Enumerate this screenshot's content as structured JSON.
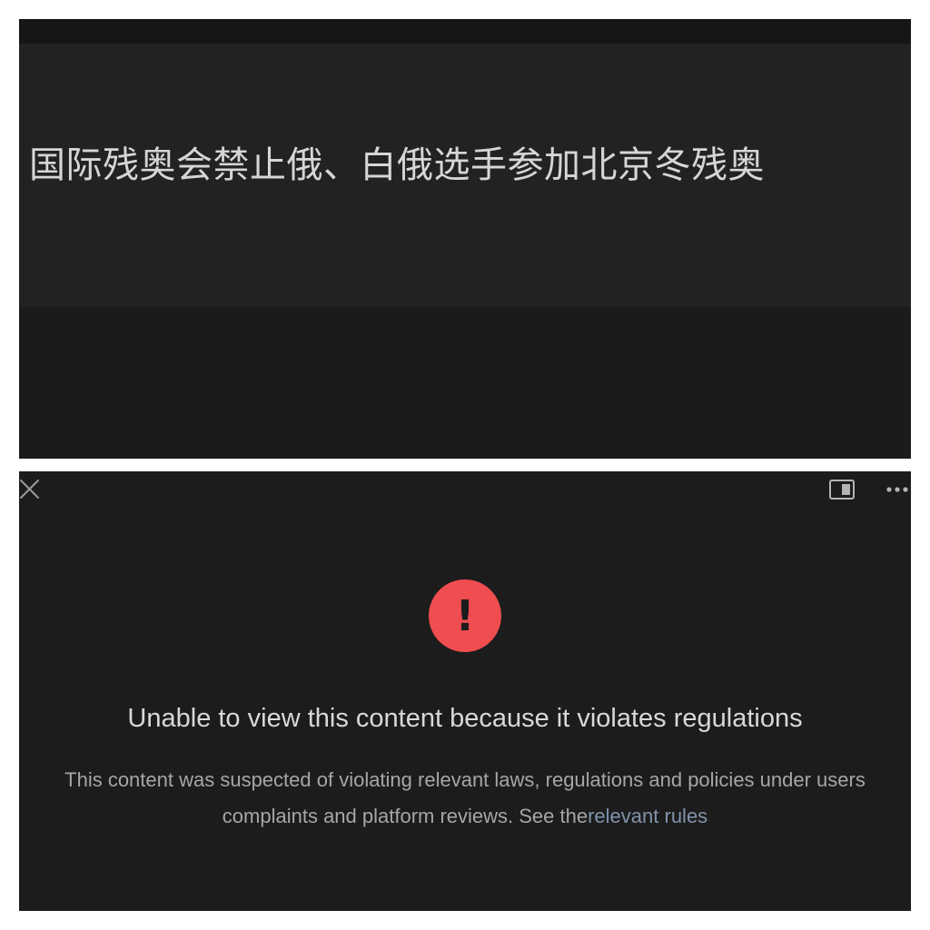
{
  "top_panel": {
    "headline": "国际残奥会禁止俄、白俄选手参加北京冬残奥"
  },
  "bottom_panel": {
    "toolbar": {
      "close_icon": "close-icon",
      "split_view_icon": "split-view-icon",
      "more_icon": "more-options-icon"
    },
    "alert": {
      "icon": "exclamation-icon",
      "icon_glyph": "!",
      "icon_color": "#f04d50"
    },
    "title": "Unable to view this content because it violates regulations",
    "message": "This content was suspected of violating relevant laws, regulations and policies under users complaints and platform reviews. See the",
    "link_text": "relevant rules",
    "link_color": "#8193ac"
  },
  "colors": {
    "background": "#1c1c1c",
    "headline_band": "#222222",
    "frame": "#ffffff"
  }
}
